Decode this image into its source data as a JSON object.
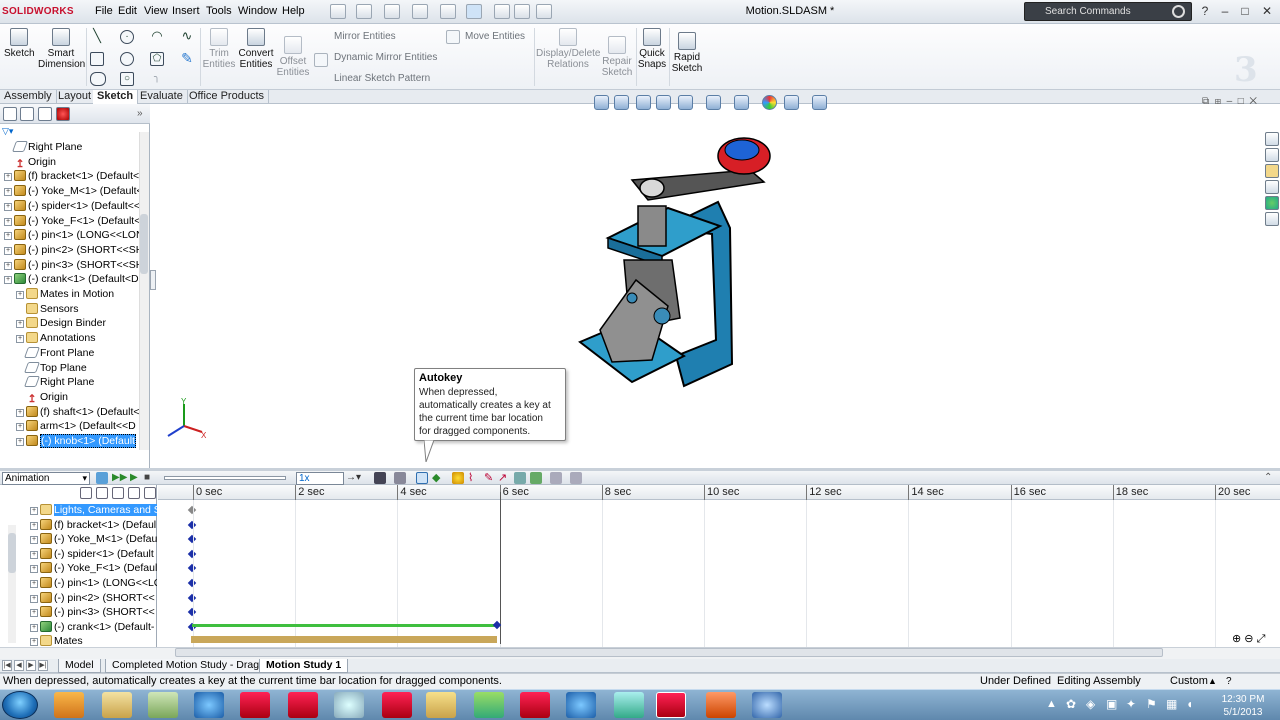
{
  "titlebar": {
    "logo_text": "SOLIDWORKS",
    "menus": [
      "File",
      "Edit",
      "View",
      "Insert",
      "Tools",
      "Window",
      "Help"
    ],
    "document_title": "Motion.SLDASM *",
    "search_placeholder": "Search Commands"
  },
  "ribbon": {
    "sketch": "Sketch",
    "smart_dimension_1": "Smart",
    "smart_dimension_2": "Dimension",
    "trim_1": "Trim",
    "trim_2": "Entities",
    "convert_1": "Convert",
    "convert_2": "Entities",
    "offset_1": "Offset",
    "offset_2": "Entities",
    "mirror": "Mirror Entities",
    "dynamic_mirror": "Dynamic Mirror Entities",
    "linear_pattern": "Linear Sketch Pattern",
    "move": "Move Entities",
    "display_delete_1": "Display/Delete",
    "display_delete_2": "Relations",
    "repair_1": "Repair",
    "repair_2": "Sketch",
    "quick_snaps_1": "Quick",
    "quick_snaps_2": "Snaps",
    "rapid_sketch_1": "Rapid",
    "rapid_sketch_2": "Sketch"
  },
  "command_tabs": [
    "Assembly",
    "Layout",
    "Sketch",
    "Evaluate",
    "Office Products"
  ],
  "active_command_tab": "Sketch",
  "feature_tree": [
    {
      "label": "Right Plane",
      "type": "plane",
      "indent": 0,
      "expand": false
    },
    {
      "label": "Origin",
      "type": "origin",
      "indent": 0,
      "expand": false
    },
    {
      "label": "(f) bracket<1> (Default<",
      "type": "part",
      "indent": 0,
      "expand": true
    },
    {
      "label": "(-) Yoke_M<1> (Default<",
      "type": "part",
      "indent": 0,
      "expand": true
    },
    {
      "label": "(-) spider<1> (Default<<",
      "type": "part",
      "indent": 0,
      "expand": true
    },
    {
      "label": "(-) Yoke_F<1> (Default<",
      "type": "part",
      "indent": 0,
      "expand": true
    },
    {
      "label": "(-) pin<1> (LONG<<LON",
      "type": "part",
      "indent": 0,
      "expand": true
    },
    {
      "label": "(-) pin<2> (SHORT<<SH",
      "type": "part",
      "indent": 0,
      "expand": true
    },
    {
      "label": "(-) pin<3> (SHORT<<SH",
      "type": "part",
      "indent": 0,
      "expand": true
    },
    {
      "label": "(-) crank<1> (Default<D",
      "type": "asm",
      "indent": 0,
      "expand": true
    },
    {
      "label": "Mates in Motion",
      "type": "folder",
      "indent": 1,
      "expand": true
    },
    {
      "label": "Sensors",
      "type": "folder",
      "indent": 1,
      "expand": false
    },
    {
      "label": "Design Binder",
      "type": "folder",
      "indent": 1,
      "expand": true
    },
    {
      "label": "Annotations",
      "type": "folder",
      "indent": 1,
      "expand": true
    },
    {
      "label": "Front Plane",
      "type": "plane",
      "indent": 1,
      "expand": false
    },
    {
      "label": "Top Plane",
      "type": "plane",
      "indent": 1,
      "expand": false
    },
    {
      "label": "Right Plane",
      "type": "plane",
      "indent": 1,
      "expand": false
    },
    {
      "label": "Origin",
      "type": "origin",
      "indent": 1,
      "expand": false
    },
    {
      "label": "(f) shaft<1> (Default<",
      "type": "part",
      "indent": 1,
      "expand": true
    },
    {
      "label": "arm<1> (Default<<D",
      "type": "part",
      "indent": 1,
      "expand": true
    },
    {
      "label": "(-) knob<1> (Default",
      "type": "part",
      "indent": 1,
      "expand": true,
      "selected": true
    }
  ],
  "tooltip": {
    "title": "Autokey",
    "lines": [
      "When depressed,",
      "automatically creates a key at",
      "the current time bar location",
      "for dragged components."
    ]
  },
  "motion_manager": {
    "study_type": "Animation",
    "speed": "1x",
    "time_labels": [
      "0 sec",
      "2 sec",
      "4 sec",
      "6 sec",
      "8 sec",
      "10 sec",
      "12 sec",
      "14 sec",
      "16 sec",
      "18 sec",
      "20 sec"
    ],
    "rows": [
      {
        "label": "Lights, Cameras and Sc",
        "type": "folder",
        "selected": true,
        "key": "grey"
      },
      {
        "label": "(f) bracket<1> (Defaul",
        "type": "part",
        "key": "blue"
      },
      {
        "label": "(-) Yoke_M<1> (Defau",
        "type": "part",
        "key": "blue"
      },
      {
        "label": "(-) spider<1> (Default",
        "type": "part",
        "key": "blue"
      },
      {
        "label": "(-) Yoke_F<1> (Defaul",
        "type": "part",
        "key": "blue"
      },
      {
        "label": "(-) pin<1> (LONG<<LO",
        "type": "part",
        "key": "blue"
      },
      {
        "label": "(-) pin<2> (SHORT<<",
        "type": "part",
        "key": "blue"
      },
      {
        "label": "(-) pin<3> (SHORT<<",
        "type": "part",
        "key": "blue"
      },
      {
        "label": "(-) crank<1> (Default-",
        "type": "asm",
        "key": "blue"
      },
      {
        "label": "Mates",
        "type": "folder",
        "key": "none"
      }
    ],
    "timebar_sec": 6
  },
  "bottom_tabs": [
    "Model",
    "Completed Motion Study - Drag",
    "Motion Study 1"
  ],
  "active_bottom_tab": "Motion Study 1",
  "status": {
    "message": "When depressed, automatically creates a key at the current time bar location for dragged components.",
    "define_state": "Under Defined",
    "mode": "Editing Assembly",
    "units": "Custom"
  },
  "clock": {
    "time": "12:30 PM",
    "date": "5/1/2013"
  },
  "colors": {
    "accent": "#3399ff",
    "brand": "#c8102e",
    "part_blue": "#2f9ecb",
    "key_blue": "#1b2fa8",
    "timeline_green": "#3fbf3f"
  }
}
